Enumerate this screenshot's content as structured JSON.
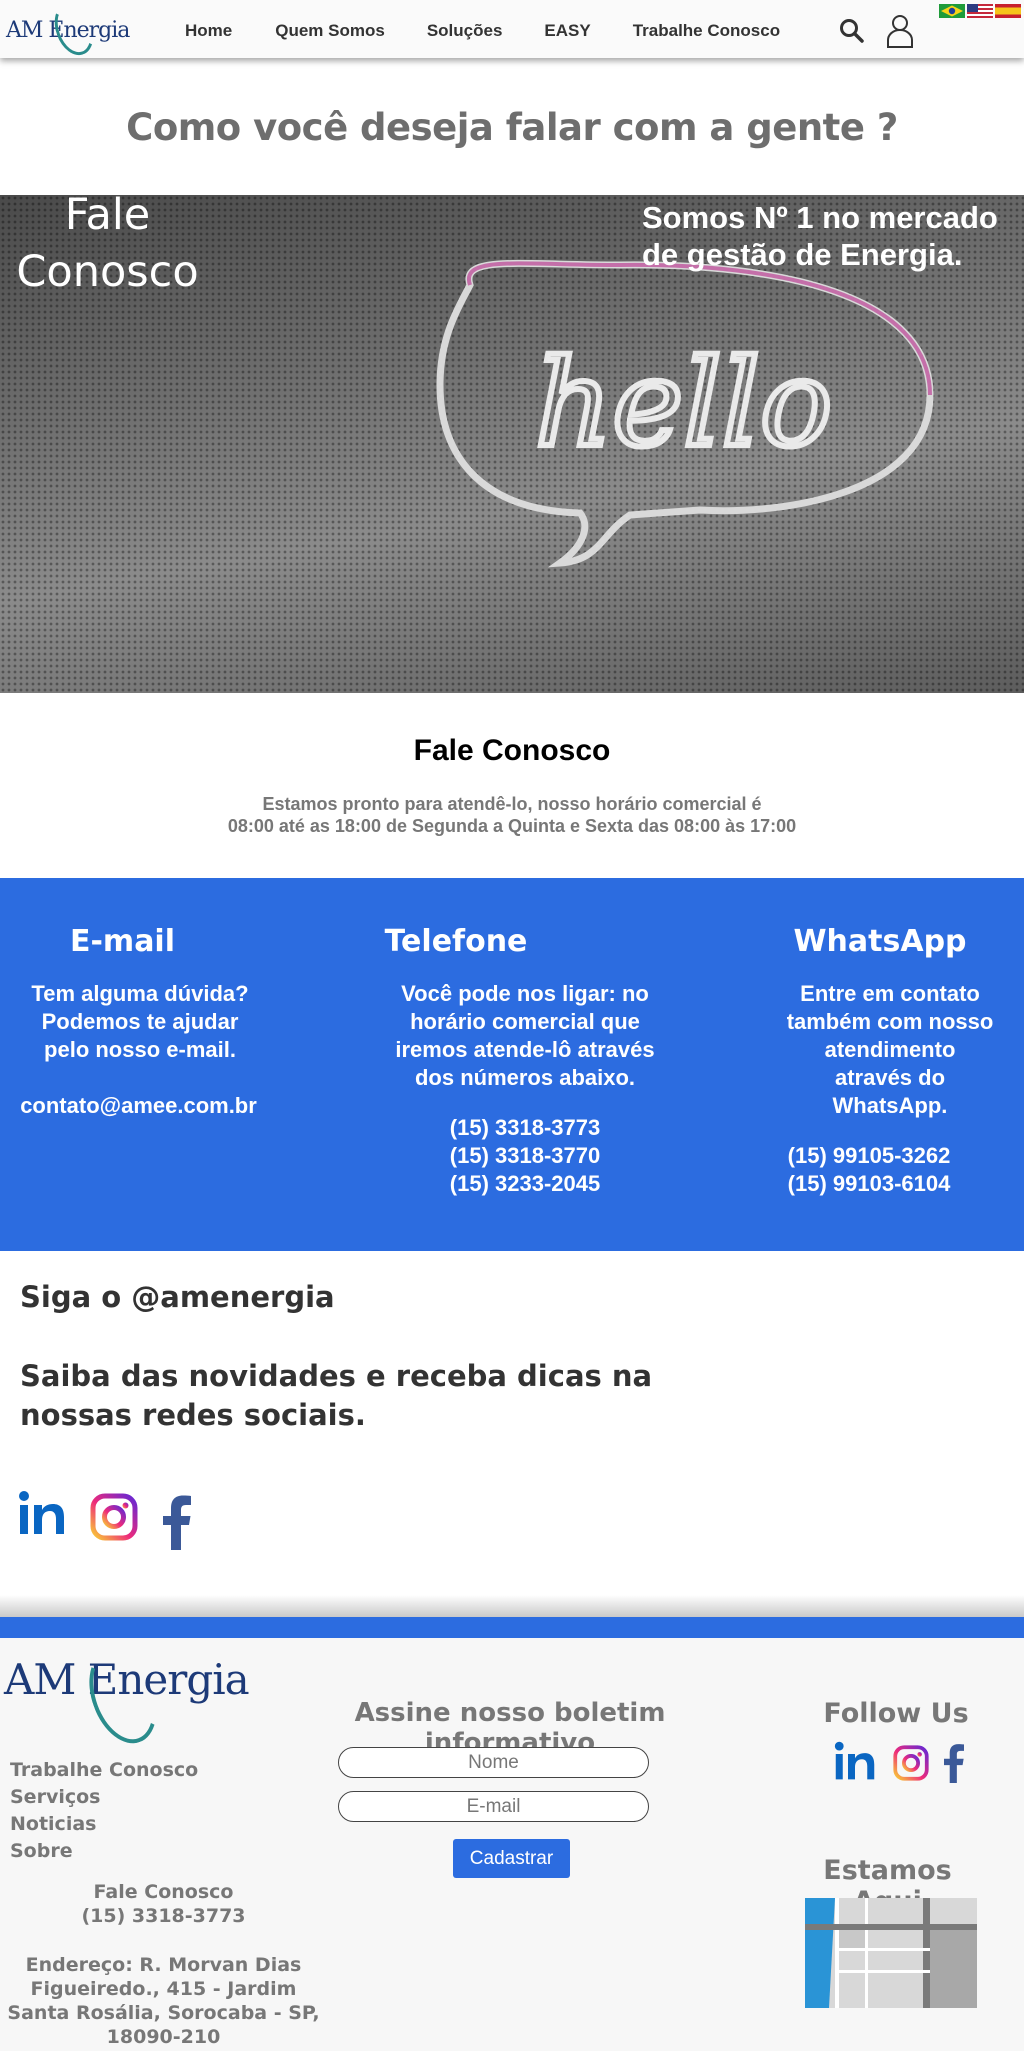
{
  "header": {
    "logo": "AM Energia",
    "nav": [
      "Home",
      "Quem Somos",
      "Soluções",
      "EASY",
      "Trabalhe Conosco"
    ],
    "icons": [
      "search-icon",
      "user-icon"
    ],
    "languages": [
      "pt-BR flag",
      "en-US flag",
      "es flag"
    ]
  },
  "main_title": "Como você deseja falar com a gente ?",
  "hero": {
    "left_title": "Fale Conosco",
    "right_title_line1": "Somos Nº 1 no mercado",
    "right_title_line2": "de gestão de Energia.",
    "neon": "hello"
  },
  "contact": {
    "title": "Fale Conosco",
    "line1": "Estamos pronto para atendê-lo, nosso horário comercial é",
    "line2": "08:00 até as 18:00 de Segunda a Quinta e Sexta das 08:00 às 17:00"
  },
  "email_col": {
    "title": "E-mail",
    "l1": "Tem alguma dúvida?",
    "l2": "Podemos te ajudar",
    "l3": "pelo nosso e-mail.",
    "address": "contato@amee.com.br"
  },
  "phone_col": {
    "title": "Telefone",
    "l1": "Você pode nos ligar: no",
    "l2": "horário comercial que",
    "l3": "iremos atende-lô através",
    "l4": "dos números abaixo.",
    "numbers": [
      "(15) 3318-3773",
      "(15) 3318-3770",
      "(15) 3233-2045"
    ]
  },
  "whatsapp_col": {
    "title": "WhatsApp",
    "l1": "Entre em contato",
    "l2": "também com nosso",
    "l3": "atendimento",
    "l4": "através do",
    "l5": "WhatsApp.",
    "numbers": [
      "(15) 99105-3262",
      "(15) 99103-6104"
    ]
  },
  "social": {
    "handle": "Siga o @amenergia",
    "text": "Saiba das novidades e receba dicas na nossas redes sociais.",
    "icons": [
      "linkedin-icon",
      "instagram-icon",
      "facebook-icon"
    ]
  },
  "footer": {
    "logo": "AM Energia",
    "links": [
      "Trabalhe Conosco",
      "Serviços",
      "Noticias",
      "Sobre"
    ],
    "contact_label": "Fale Conosco",
    "contact_phone": "(15) 3318-3773",
    "address": "Endereço: R. Morvan Dias Figueiredo., 415 - Jardim Santa Rosália, Sorocaba - SP, 18090-210",
    "newsletter_title": "Assine nosso boletim informativo",
    "name_placeholder": "Nome",
    "email_placeholder": "E-mail",
    "submit": "Cadastrar",
    "follow": "Follow Us",
    "here": "Estamos Aqui"
  },
  "colors": {
    "brand_blue": "#2c6ce0",
    "text_gray": "#777777",
    "logo_navy": "#1d3a78"
  }
}
